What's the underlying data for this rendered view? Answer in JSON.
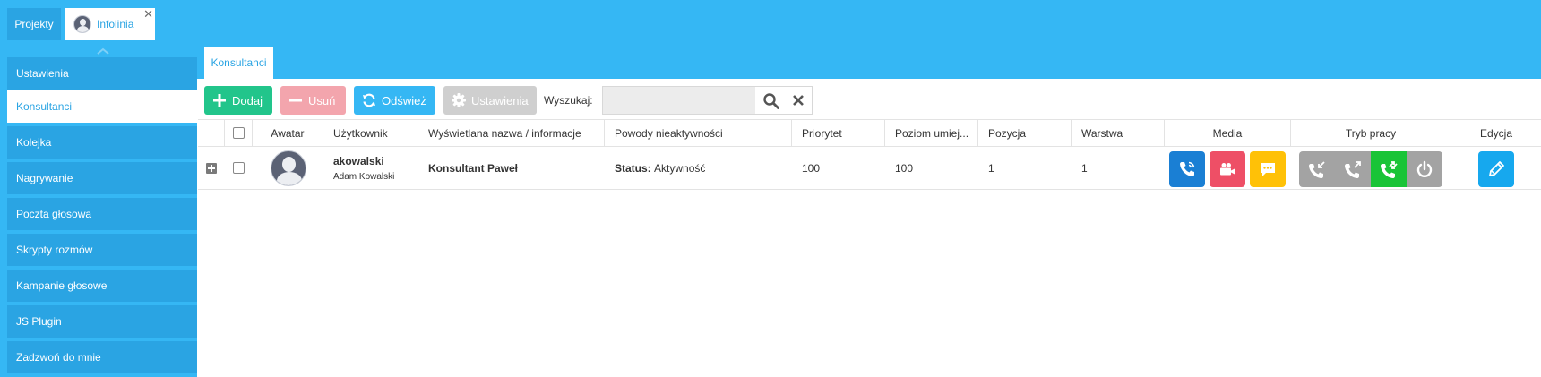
{
  "top_tabs": {
    "projects_label": "Projekty",
    "infolinia_label": "Infolinia",
    "close_symbol": "✕"
  },
  "sidebar": {
    "items": [
      {
        "label": "Ustawienia"
      },
      {
        "label": "Konsultanci",
        "active": true
      },
      {
        "label": "Kolejka"
      },
      {
        "label": "Nagrywanie"
      },
      {
        "label": "Poczta głosowa"
      },
      {
        "label": "Skrypty rozmów"
      },
      {
        "label": "Kampanie głosowe"
      },
      {
        "label": "JS Plugin"
      },
      {
        "label": "Zadzwoń do mnie"
      }
    ]
  },
  "content_tab": {
    "label": "Konsultanci"
  },
  "toolbar": {
    "add_label": "Dodaj",
    "delete_label": "Usuń",
    "refresh_label": "Odśwież",
    "settings_label": "Ustawienia",
    "search_label": "Wyszukaj:",
    "search_value": "",
    "search_placeholder": ""
  },
  "table": {
    "columns": {
      "avatar": "Awatar",
      "user": "Użytkownik",
      "display_name": "Wyświetlana nazwa / informacje",
      "inactivity": "Powody nieaktywności",
      "priority": "Priorytet",
      "skill_level": "Poziom umiej...",
      "position": "Pozycja",
      "layer": "Warstwa",
      "media": "Media",
      "work_mode": "Tryb pracy",
      "edit": "Edycja"
    },
    "rows": [
      {
        "login": "akowalski",
        "full_name": "Adam Kowalski",
        "display_name": "Konsultant Paweł",
        "status_label": "Status:",
        "status_value": "Aktywność",
        "priority": "100",
        "skill_level": "100",
        "position": "1",
        "layer": "1"
      }
    ]
  },
  "icons": {
    "media": [
      "phone-icon",
      "video-camera-icon",
      "chat-icon"
    ],
    "work_mode": [
      "phone-incoming-icon",
      "phone-outgoing-icon",
      "phone-inbound-outbound-icon",
      "power-icon"
    ],
    "edit": "pencil-icon"
  },
  "colors": {
    "header_blue": "#35b7f4",
    "nav_blue": "#2aa4e3",
    "add_green": "#22c58b",
    "delete_pink": "#f3a5ad",
    "media_phone": "#1a7fd4",
    "media_video": "#ee4f66",
    "media_chat": "#ffc107",
    "mode_inactive": "#a3a3a3",
    "mode_active": "#19c437",
    "edit_blue": "#16a8ee"
  }
}
